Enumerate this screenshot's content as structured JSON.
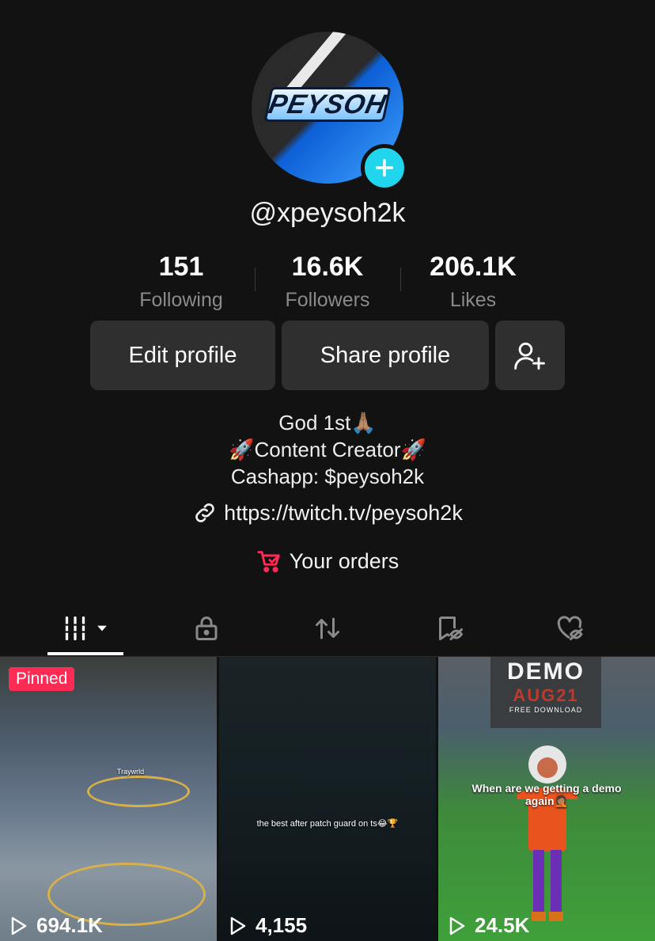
{
  "profile": {
    "avatar_text": "PEYSOH",
    "username": "@xpeysoh2k"
  },
  "stats": [
    {
      "value": "151",
      "label": "Following"
    },
    {
      "value": "16.6K",
      "label": "Followers"
    },
    {
      "value": "206.1K",
      "label": "Likes"
    }
  ],
  "actions": {
    "edit_label": "Edit profile",
    "share_label": "Share profile",
    "add_friend_icon": "person-add-icon"
  },
  "bio": {
    "line1": "God 1st🙏🏽",
    "line2": "🚀Content Creator🚀",
    "line3": "Cashapp: $peysoh2k"
  },
  "link": {
    "icon": "link-icon",
    "url": "https://twitch.tv/peysoh2k"
  },
  "orders": {
    "icon": "cart-icon",
    "label": "Your orders"
  },
  "tabs": [
    {
      "icon": "videos-grid-icon",
      "active": true
    },
    {
      "icon": "lock-icon",
      "active": false
    },
    {
      "icon": "repost-icon",
      "active": false
    },
    {
      "icon": "saved-hidden-icon",
      "active": false
    },
    {
      "icon": "liked-hidden-icon",
      "active": false
    }
  ],
  "videos": [
    {
      "badge": "Pinned",
      "views": "694.1K",
      "caption": "Traywrld"
    },
    {
      "badge": "",
      "views": "4,155",
      "caption": "the best after patch guard on ts😂🏆"
    },
    {
      "badge": "",
      "views": "24.5K",
      "caption": "When are we getting a demo again🤦🏽",
      "overlay_title": "DEMO",
      "overlay_date": "AUG21",
      "overlay_sub": "FREE DOWNLOAD"
    }
  ],
  "colors": {
    "background": "#121212",
    "accent_cyan": "#20d5ec",
    "pinned_red": "#fe2c55",
    "button_gray": "#2f2f2f"
  }
}
